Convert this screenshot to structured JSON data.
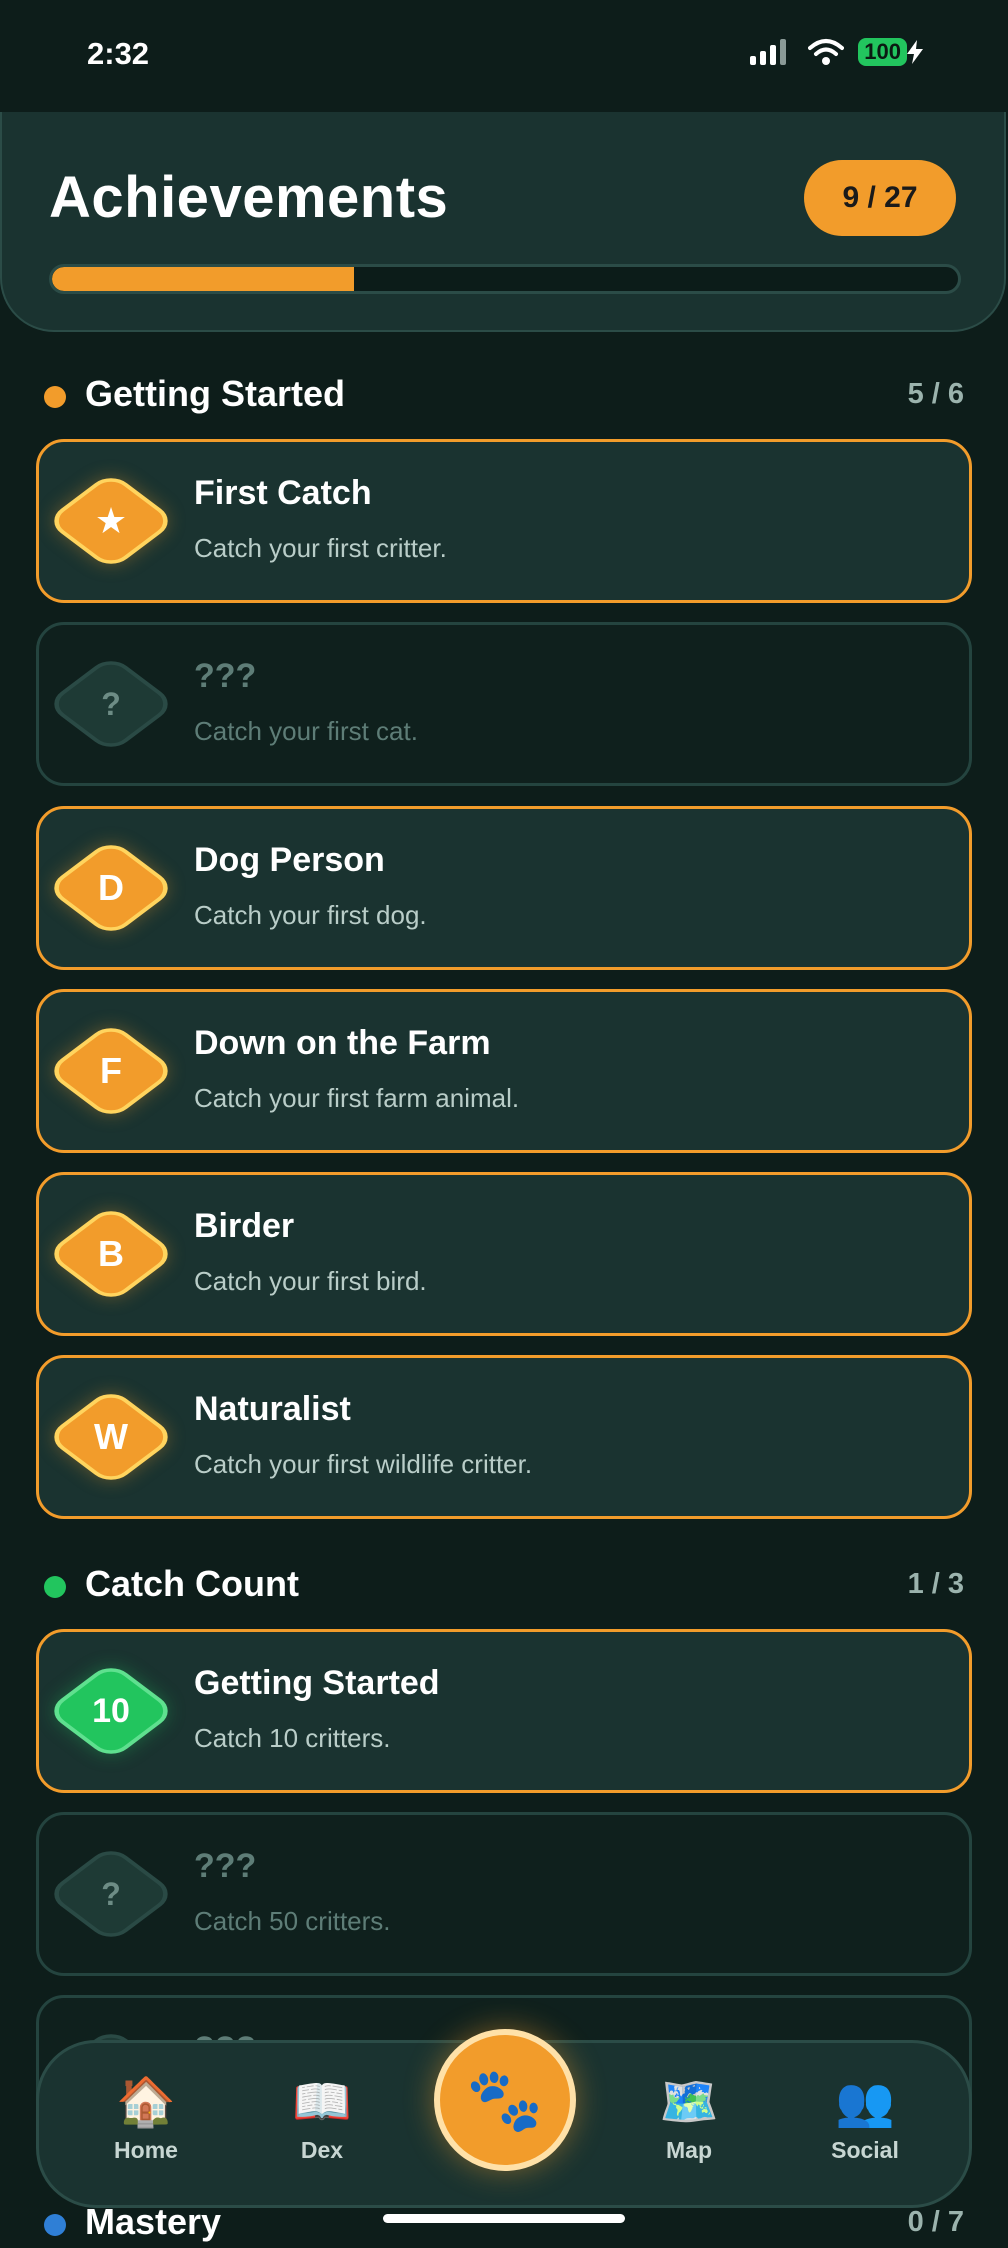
{
  "status": {
    "time": "2:32",
    "battery": "100"
  },
  "header": {
    "title": "Achievements",
    "count": "9 / 27",
    "progress_fraction": 0.333
  },
  "sections": [
    {
      "title": "Getting Started",
      "count": "5 / 6",
      "dot_color": "#f29c2b",
      "items": [
        {
          "badge": "★",
          "title": "First Catch",
          "desc": "Catch your first critter.",
          "locked": false
        },
        {
          "badge": "?",
          "title": "???",
          "desc": "Catch your first cat.",
          "locked": true
        },
        {
          "badge": "D",
          "title": "Dog Person",
          "desc": "Catch your first dog.",
          "locked": false
        },
        {
          "badge": "F",
          "title": "Down on the Farm",
          "desc": "Catch your first farm animal.",
          "locked": false
        },
        {
          "badge": "B",
          "title": "Birder",
          "desc": "Catch your first bird.",
          "locked": false
        },
        {
          "badge": "W",
          "title": "Naturalist",
          "desc": "Catch your first wildlife critter.",
          "locked": false
        }
      ]
    },
    {
      "title": "Catch Count",
      "count": "1 / 3",
      "dot_color": "#22c55e",
      "items": [
        {
          "badge": "10",
          "title": "Getting Started",
          "desc": "Catch 10 critters.",
          "locked": false
        },
        {
          "badge": "?",
          "title": "???",
          "desc": "Catch 50 critters.",
          "locked": true
        },
        {
          "badge": "?",
          "title": "???",
          "desc": "",
          "locked": true
        }
      ]
    },
    {
      "title": "Mastery",
      "count": "0 / 7",
      "dot_color": "#2f7fd6"
    }
  ],
  "nav": {
    "home": "Home",
    "dex": "Dex",
    "map": "Map",
    "social": "Social",
    "home_icon": "house-icon",
    "dex_icon": "book-icon",
    "catch_icon": "paw-icon",
    "map_icon": "map-icon",
    "social_icon": "people-icon"
  },
  "colors": {
    "accent": "#f29c2b",
    "green": "#22c55e",
    "background": "#0d1d1a",
    "card": "#1a3330"
  }
}
